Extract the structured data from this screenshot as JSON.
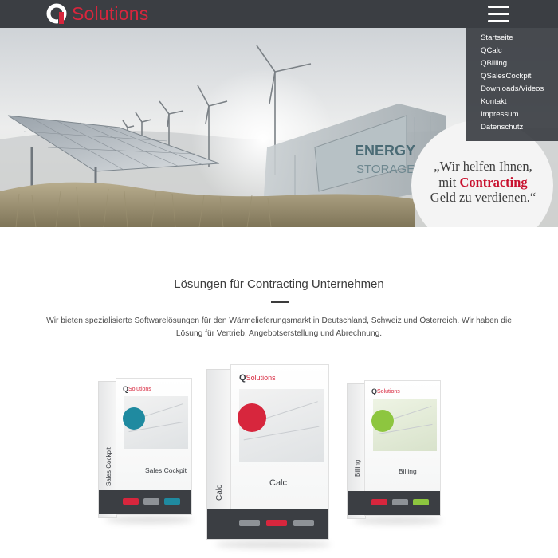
{
  "header": {
    "logo_mark": "Q",
    "logo_text": "Solutions",
    "menu_icon": "hamburger-menu-icon"
  },
  "nav": {
    "items": [
      {
        "label": "Startseite"
      },
      {
        "label": "QCalc"
      },
      {
        "label": "QBilling"
      },
      {
        "label": "QSalesCockpit"
      },
      {
        "label": "Downloads/Videos"
      },
      {
        "label": "Kontakt"
      },
      {
        "label": "Impressum"
      },
      {
        "label": "Datenschutz"
      }
    ]
  },
  "hero": {
    "quote_line1": "„Wir helfen Ihnen,",
    "quote_line2_pre": "mit ",
    "quote_highlight": "Contracting",
    "quote_line3": "Geld zu verdienen.“",
    "container_text_1": "ENERGY",
    "container_text_2": "STORAGE"
  },
  "main": {
    "title": "Lösungen für Contracting Unternehmen",
    "intro": "Wir bieten spezialisierte Softwarelösungen für den Wärmelieferungsmarkt in Deutschland, Schweiz und Österreich. Wir haben die Lösung für Vertrieb, Angebotserstellung und Abrechnung."
  },
  "products": [
    {
      "brand": "Solutions",
      "name": "Sales Cockpit",
      "spine": "Sales Cockpit",
      "accent": "#1f8aa0"
    },
    {
      "brand": "Solutions",
      "name": "Calc",
      "spine": "Calc",
      "accent": "#d7263d"
    },
    {
      "brand": "Solutions",
      "name": "Billing",
      "spine": "Billing",
      "accent": "#8dc63f"
    }
  ],
  "colors": {
    "header_bg": "#3b3e43",
    "brand_red": "#d7263d",
    "highlight": "#c8102e"
  }
}
